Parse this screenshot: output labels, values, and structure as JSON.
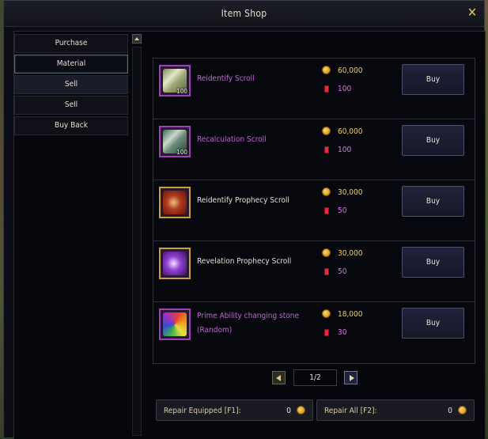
{
  "window": {
    "title": "Item Shop"
  },
  "menu": {
    "items": [
      {
        "label": "Purchase"
      },
      {
        "label": "Material"
      },
      {
        "label": "Sell"
      },
      {
        "label": "Sell"
      },
      {
        "label": "Buy Back"
      }
    ],
    "selected_index": 1
  },
  "items": [
    {
      "name": "Reidentify Scroll",
      "quantity": "100",
      "price": "60,000",
      "count": "100",
      "buy_label": "Buy",
      "icon": "scroll-icon",
      "color": "#c065d8"
    },
    {
      "name": "Recalculation Scroll",
      "quantity": "100",
      "price": "60,000",
      "count": "100",
      "buy_label": "Buy",
      "icon": "scroll-icon",
      "color": "#c065d8"
    },
    {
      "name": "Reidentify Prophecy Scroll",
      "quantity": "",
      "price": "30,000",
      "count": "50",
      "buy_label": "Buy",
      "icon": "prophecy-scroll-icon",
      "color": "#e4e0d2"
    },
    {
      "name": "Revelation Prophecy Scroll",
      "quantity": "",
      "price": "30,000",
      "count": "50",
      "buy_label": "Buy",
      "icon": "prophecy-scroll-icon",
      "color": "#e4e0d2"
    },
    {
      "name": "Prime Ability changing stone",
      "name2": "(Random)",
      "quantity": "",
      "price": "18,000",
      "count": "30",
      "buy_label": "Buy",
      "icon": "stone-icon",
      "color": "#c065d8"
    }
  ],
  "pager": {
    "page": "1/2"
  },
  "repair": {
    "equipped_label": "Repair Equipped [F1]:",
    "equipped_value": "0",
    "all_label": "Repair All [F2]:",
    "all_value": "0"
  },
  "colors": {
    "gold": "#f0d25a",
    "rare": "#c065d8",
    "accent": "#e6c35a"
  }
}
